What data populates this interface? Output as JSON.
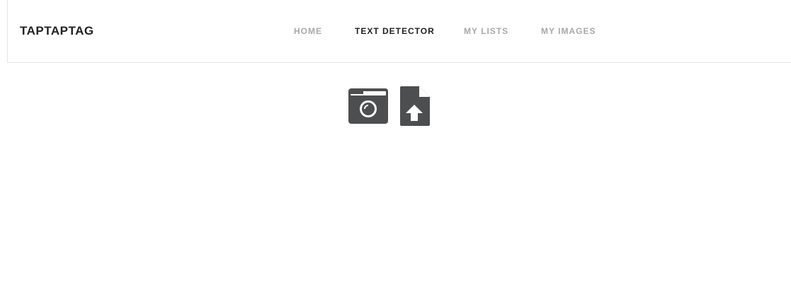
{
  "header": {
    "brand": "TAPTAPTAG",
    "nav": [
      {
        "label": "HOME",
        "active": false
      },
      {
        "label": "TEXT DETECTOR",
        "active": true
      },
      {
        "label": "MY LISTS",
        "active": false
      },
      {
        "label": "MY IMAGES",
        "active": false
      }
    ]
  },
  "tools": {
    "camera": {
      "icon": "camera-icon"
    },
    "upload": {
      "icon": "file-upload-icon"
    }
  },
  "colors": {
    "icon": "#4d4e50",
    "nav_inactive": "#a8a8a8",
    "nav_active": "#1f1f1f",
    "brand": "#222222",
    "divider": "#e6e6e6"
  }
}
